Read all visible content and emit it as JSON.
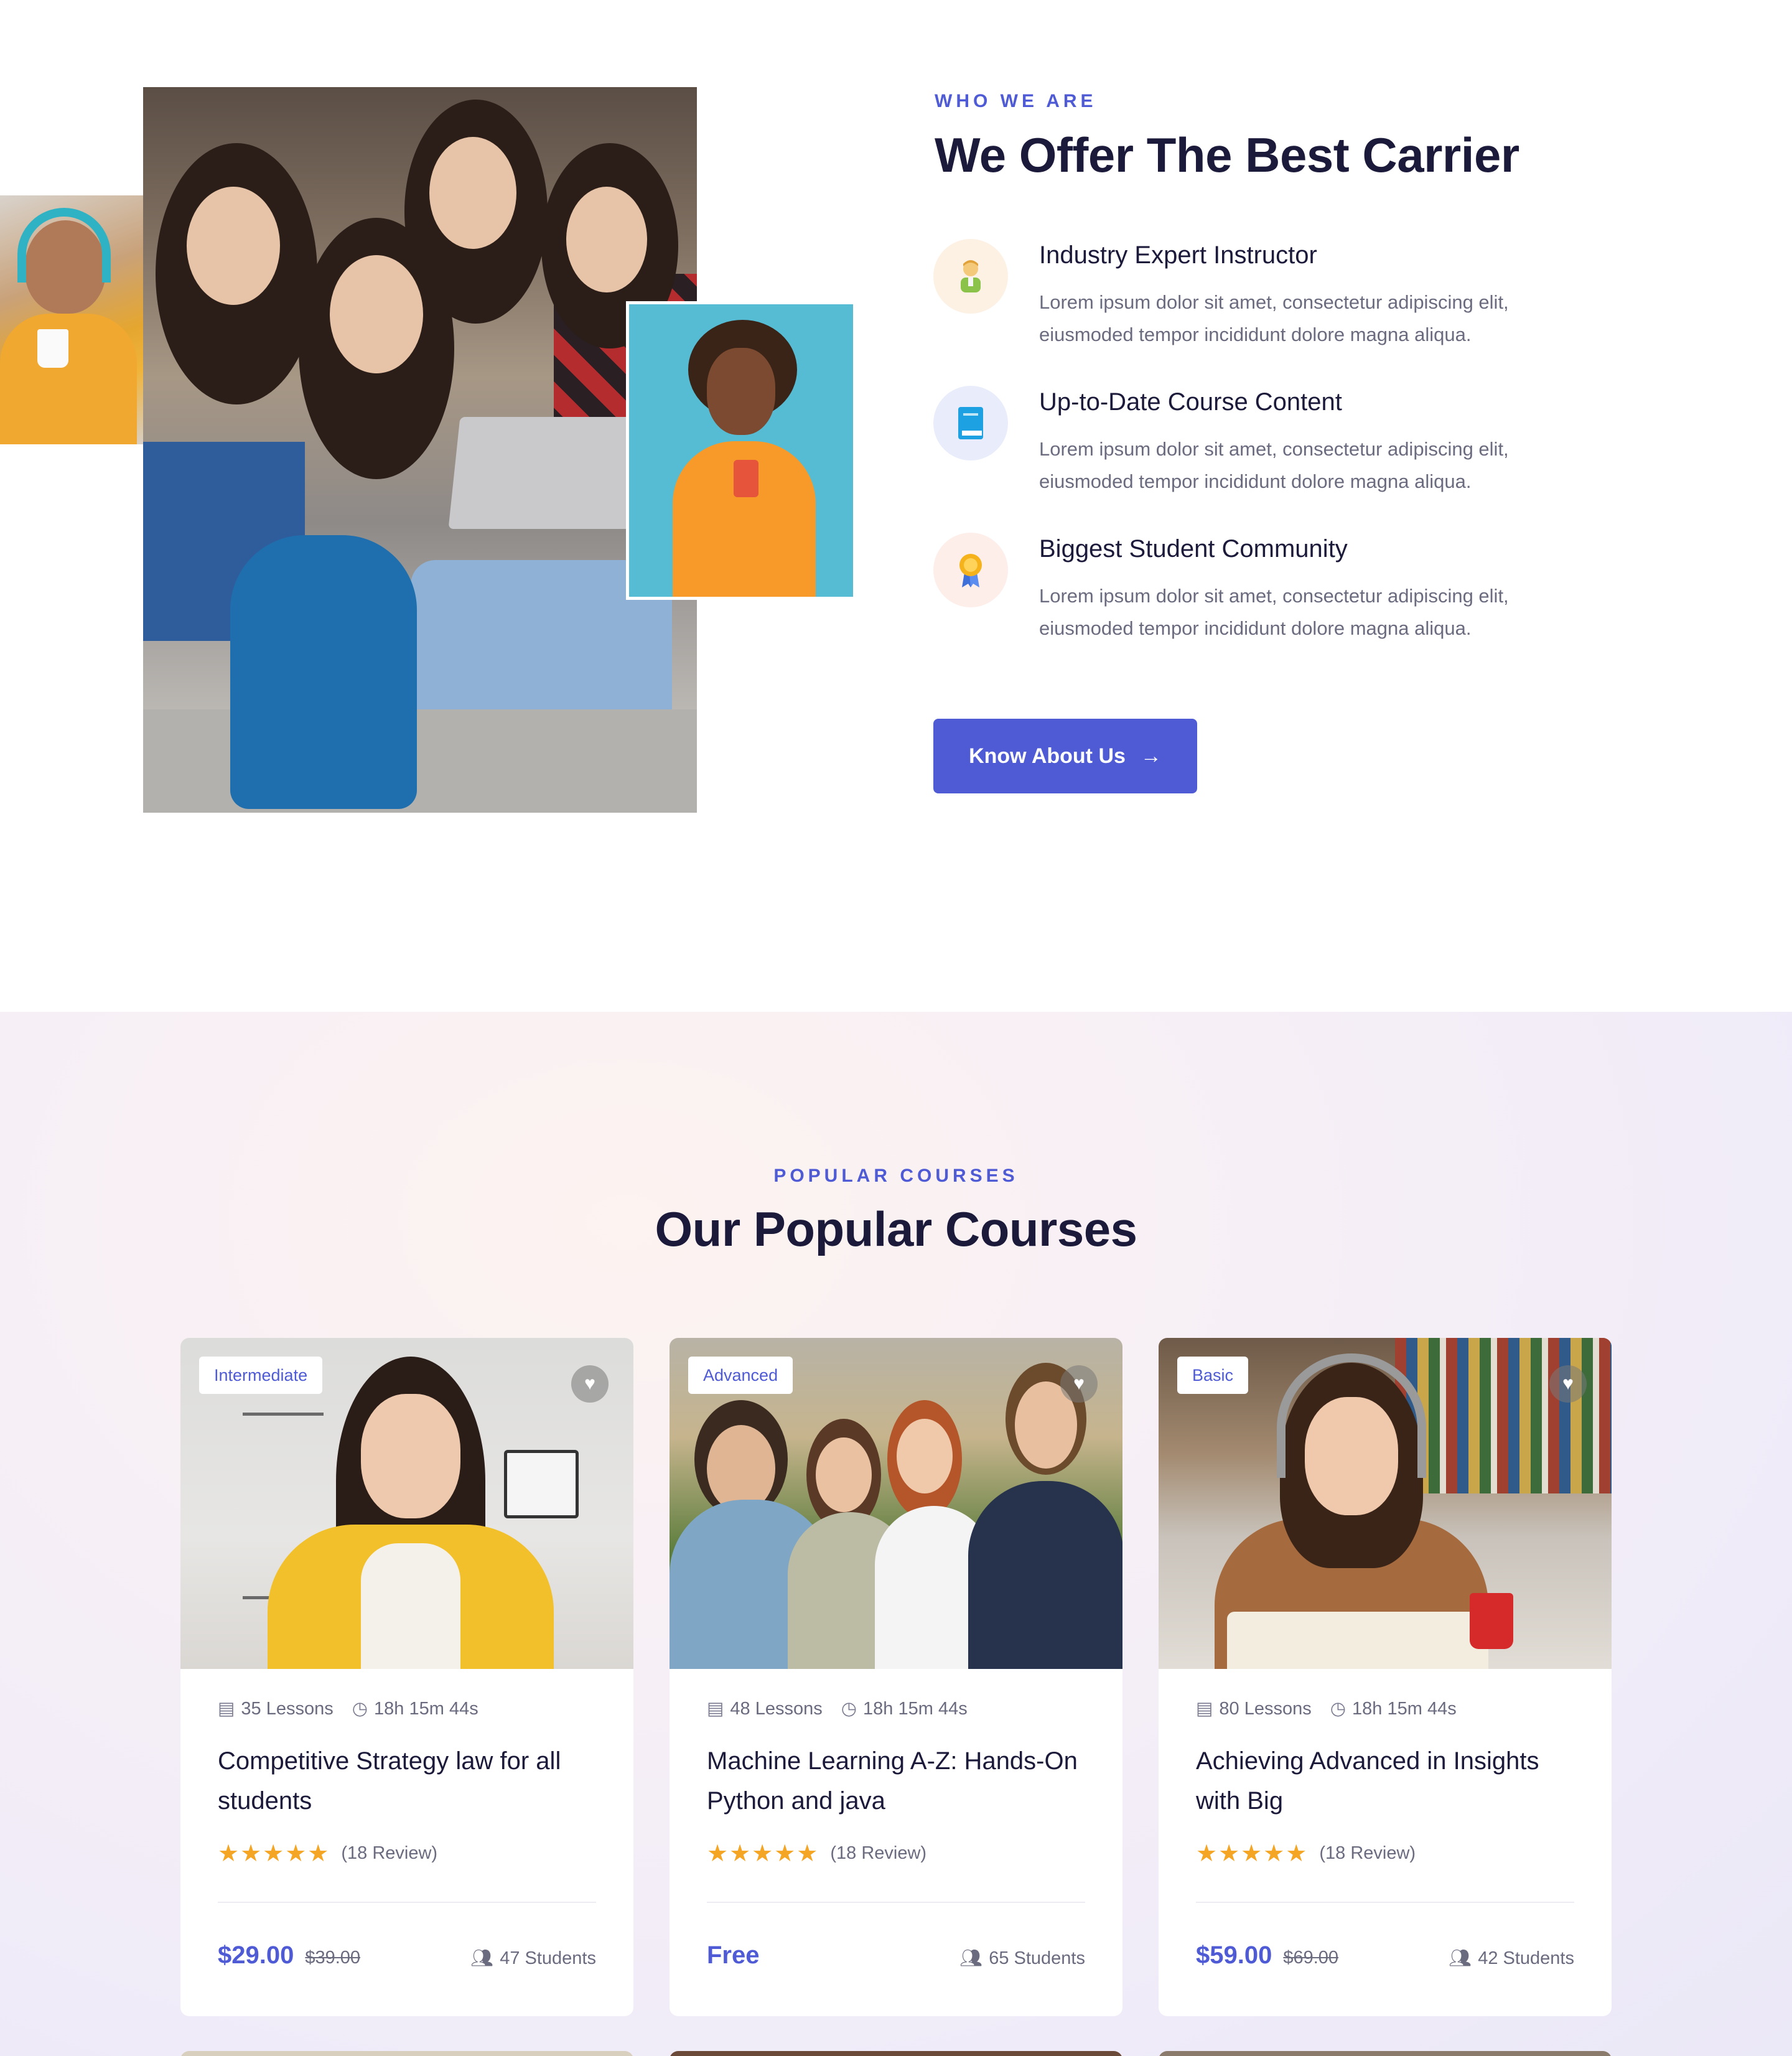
{
  "about": {
    "eyebrow": "WHO WE ARE",
    "title": "We Offer The Best Carrier",
    "features": [
      {
        "icon": "instructor-icon",
        "title": "Industry Expert Instructor",
        "text": "Lorem ipsum dolor sit amet, consectetur adipiscing elit, eiusmoded tempor incididunt dolore magna aliqua."
      },
      {
        "icon": "book-icon",
        "title": "Up-to-Date Course Content",
        "text": "Lorem ipsum dolor sit amet, consectetur adipiscing elit, eiusmoded tempor incididunt dolore magna aliqua."
      },
      {
        "icon": "medal-icon",
        "title": "Biggest Student Community",
        "text": "Lorem ipsum dolor sit amet, consectetur adipiscing elit, eiusmoded tempor incididunt dolore magna aliqua."
      }
    ],
    "button_label": "Know About Us",
    "button_icon": "arrow-right-icon"
  },
  "courses": {
    "eyebrow": "POPULAR COURSES",
    "title": "Our Popular Courses",
    "items": [
      {
        "level": "Intermediate",
        "lessons": "35 Lessons",
        "duration": "18h 15m 44s",
        "title": "Competitive Strategy law for all students",
        "rating": 5,
        "reviews": "(18 Review)",
        "price": "$29.00",
        "old_price": "$39.00",
        "students": "47 Students"
      },
      {
        "level": "Advanced",
        "lessons": "48 Lessons",
        "duration": "18h 15m 44s",
        "title": "Machine Learning A-Z: Hands-On Python and java",
        "rating": 5,
        "reviews": "(18 Review)",
        "price": "Free",
        "old_price": "",
        "students": "65 Students"
      },
      {
        "level": "Basic",
        "lessons": "80 Lessons",
        "duration": "18h 15m 44s",
        "title": "Achieving Advanced in Insights with Big",
        "rating": 5,
        "reviews": "(18 Review)",
        "price": "$59.00",
        "old_price": "$69.00",
        "students": "42 Students"
      }
    ]
  },
  "colors": {
    "accent": "#4f5bd5",
    "heading": "#1c1a3a",
    "body_text": "#6b6b80",
    "star": "#f5a524"
  }
}
